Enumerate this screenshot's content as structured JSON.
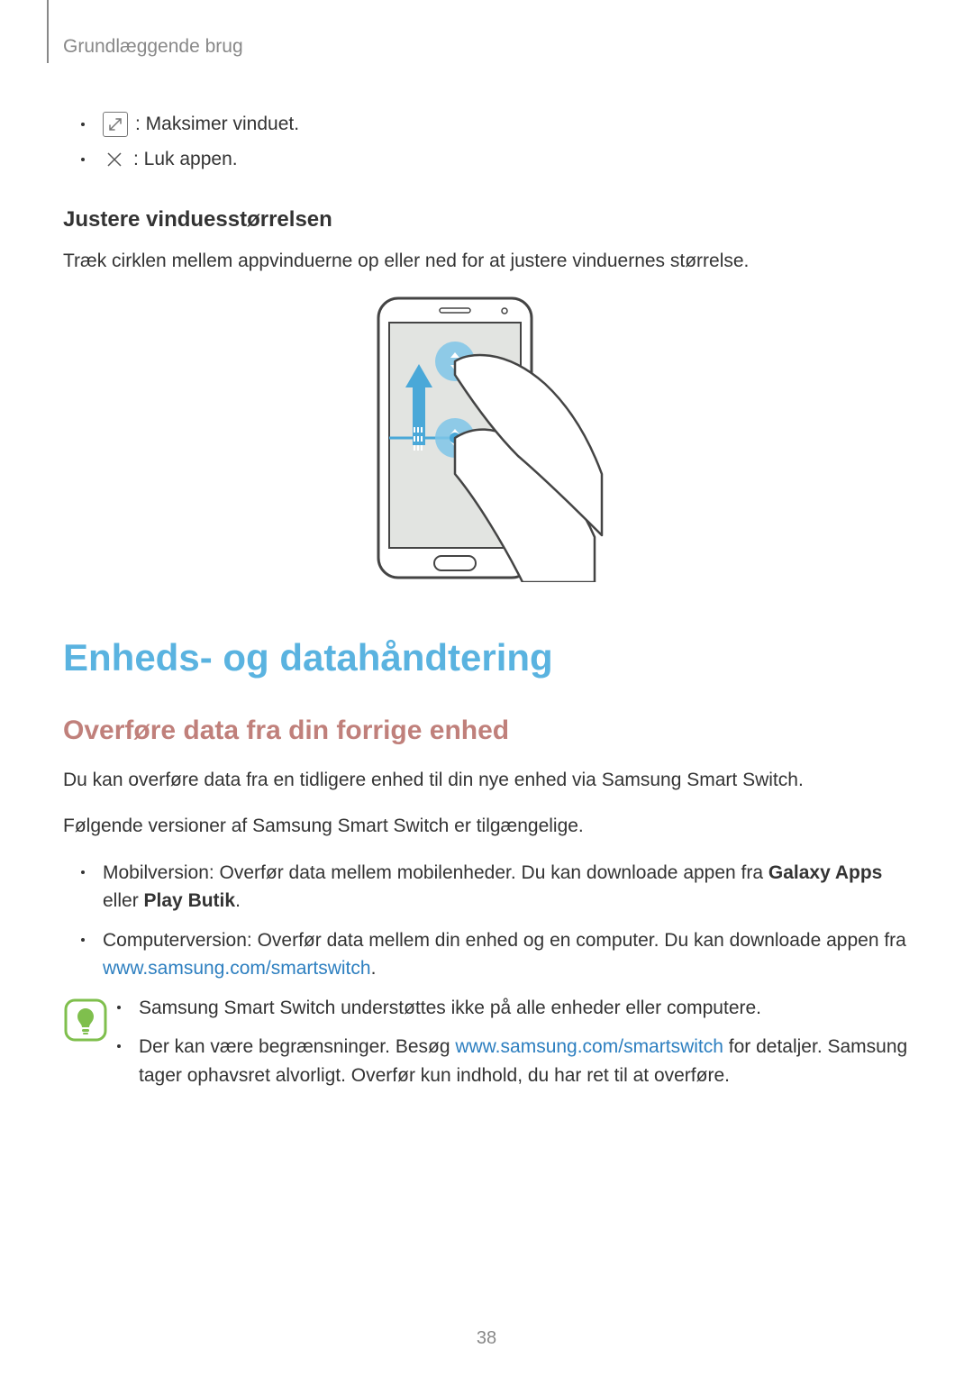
{
  "breadcrumb": "Grundlæggende brug",
  "icon_items": {
    "maximize": ": Maksimer vinduet.",
    "close": ": Luk appen."
  },
  "subheading": "Justere vinduesstørrelsen",
  "subheading_text": "Træk cirklen mellem appvinduerne op eller ned for at justere vinduernes størrelse.",
  "h1": "Enheds- og datahåndtering",
  "h2": "Overføre data fra din forrige enhed",
  "p1": "Du kan overføre data fra en tidligere enhed til din nye enhed via Samsung Smart Switch.",
  "p2": "Følgende versioner af Samsung Smart Switch er tilgængelige.",
  "list": {
    "item1_pre": "Mobilversion: Overfør data mellem mobilenheder. Du kan downloade appen fra ",
    "item1_bold1": "Galaxy Apps",
    "item1_mid": " eller ",
    "item1_bold2": "Play Butik",
    "item1_end": ".",
    "item2_pre": "Computerversion: Overfør data mellem din enhed og en computer. Du kan downloade appen fra ",
    "item2_link": "www.samsung.com/smartswitch",
    "item2_end": "."
  },
  "note": {
    "n1": "Samsung Smart Switch understøttes ikke på alle enheder eller computere.",
    "n2_pre": "Der kan være begrænsninger. Besøg ",
    "n2_link": "www.samsung.com/smartswitch",
    "n2_post": " for detaljer. Samsung tager ophavsret alvorligt. Overfør kun indhold, du har ret til at overføre."
  },
  "page_number": "38"
}
